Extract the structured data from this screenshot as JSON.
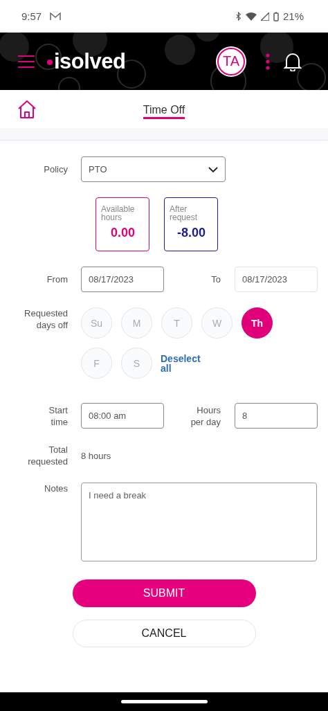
{
  "status_bar": {
    "time": "9:57",
    "battery": "21%"
  },
  "header": {
    "logo": "isolved",
    "avatar": "TA"
  },
  "nav": {
    "title": "Time Off"
  },
  "policy": {
    "label": "Policy",
    "value": "PTO"
  },
  "balances": [
    {
      "label": "Available hours",
      "value": "0.00",
      "color": "#e0007a"
    },
    {
      "label": "After request",
      "value": "-8.00",
      "color": "#1b1b8f"
    }
  ],
  "dates": {
    "from": {
      "label": "From",
      "value": "08/17/2023",
      "disabled": false
    },
    "to": {
      "label": "To",
      "value": "08/17/2023",
      "disabled": true
    }
  },
  "days": {
    "label": "Requested days off",
    "items": [
      {
        "label": "Su",
        "selected": false
      },
      {
        "label": "M",
        "selected": false
      },
      {
        "label": "T",
        "selected": false
      },
      {
        "label": "W",
        "selected": false
      },
      {
        "label": "Th",
        "selected": true
      },
      {
        "label": "F",
        "selected": false
      },
      {
        "label": "S",
        "selected": false
      }
    ],
    "deselect": "Deselect all"
  },
  "start_time": {
    "label": "Start time",
    "value": "08:00 am"
  },
  "hours_per_day": {
    "label": "Hours per day",
    "value": "8"
  },
  "total": {
    "label": "Total requested",
    "value": "8 hours"
  },
  "notes": {
    "label": "Notes",
    "value": "I need a break"
  },
  "buttons": {
    "submit": "SUBMIT",
    "cancel": "CANCEL"
  }
}
